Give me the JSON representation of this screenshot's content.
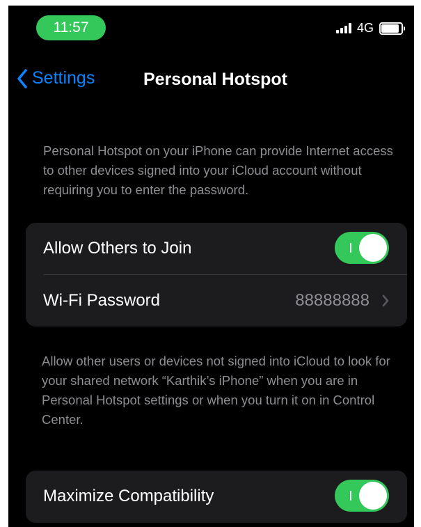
{
  "status_bar": {
    "time": "11:57",
    "network": "4G"
  },
  "nav": {
    "back_label": "Settings",
    "title": "Personal Hotspot"
  },
  "hotspot_description": "Personal Hotspot on your iPhone can provide Internet access to other devices signed into your iCloud account without requiring you to enter the password.",
  "group1": {
    "allow_others": {
      "label": "Allow Others to Join",
      "enabled": true
    },
    "wifi_password": {
      "label": "Wi-Fi Password",
      "value": "88888888"
    }
  },
  "allow_description": "Allow other users or devices not signed into iCloud to look for your shared network “Karthik’s iPhone” when you are in Personal Hotspot settings or when you turn it on in Control Center.",
  "group2": {
    "maximize": {
      "label": "Maximize Compatibility",
      "enabled": true
    }
  },
  "colors": {
    "accent_green": "#34c759",
    "link_blue": "#0a84ff",
    "background": "#000000",
    "cell": "#1c1c1e"
  }
}
